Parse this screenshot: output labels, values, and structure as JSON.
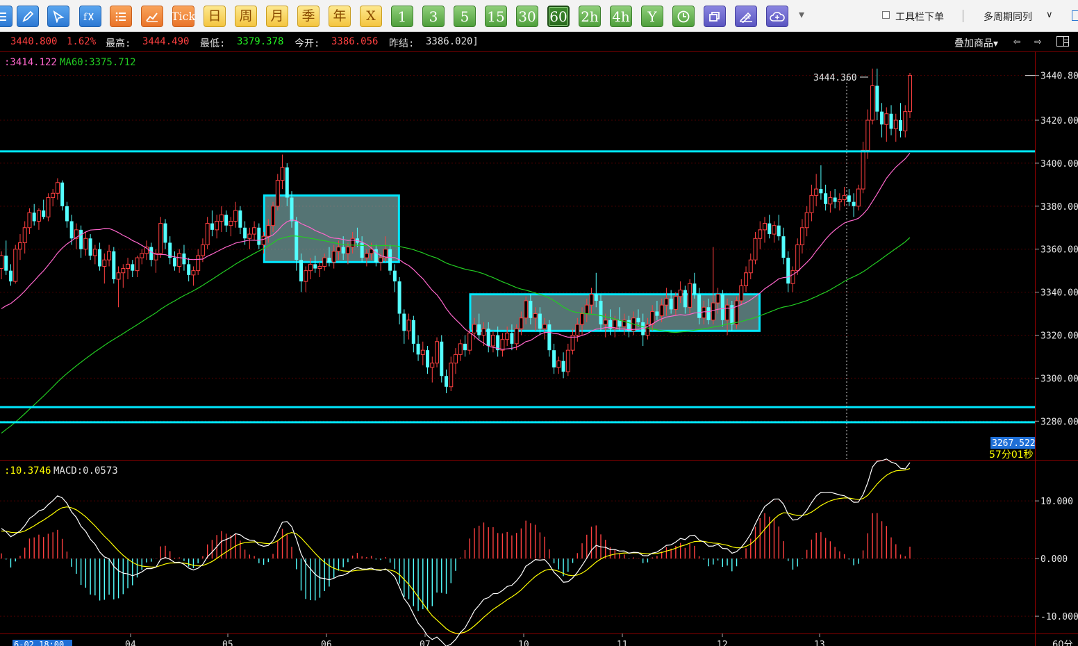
{
  "toolbar": {
    "buttons": [
      {
        "label": "",
        "icon": "menu-list-icon",
        "style": "blue"
      },
      {
        "label": "",
        "icon": "pencil-icon",
        "style": "blue"
      },
      {
        "label": "",
        "icon": "cursor-icon",
        "style": "blue"
      },
      {
        "label": "",
        "icon": "fx-formula-icon",
        "style": "blue"
      },
      {
        "label": "",
        "icon": "list-icon",
        "style": "orange"
      },
      {
        "label": "",
        "icon": "trend-chart-icon",
        "style": "orange"
      },
      {
        "label": "Tick",
        "icon": "",
        "style": "orange"
      },
      {
        "label": "日",
        "icon": "",
        "style": "yellow"
      },
      {
        "label": "周",
        "icon": "",
        "style": "yellow"
      },
      {
        "label": "月",
        "icon": "",
        "style": "yellow"
      },
      {
        "label": "季",
        "icon": "",
        "style": "yellow"
      },
      {
        "label": "年",
        "icon": "",
        "style": "yellow"
      },
      {
        "label": "X",
        "icon": "",
        "style": "yellow"
      },
      {
        "label": "1",
        "icon": "",
        "style": "green"
      },
      {
        "label": "3",
        "icon": "",
        "style": "green"
      },
      {
        "label": "5",
        "icon": "",
        "style": "green"
      },
      {
        "label": "15",
        "icon": "",
        "style": "green"
      },
      {
        "label": "30",
        "icon": "",
        "style": "green"
      },
      {
        "label": "60",
        "icon": "",
        "style": "green",
        "selected": true
      },
      {
        "label": "2h",
        "icon": "",
        "style": "green"
      },
      {
        "label": "4h",
        "icon": "",
        "style": "green"
      },
      {
        "label": "Y",
        "icon": "",
        "style": "green"
      },
      {
        "label": "",
        "icon": "clock-icon",
        "style": "green"
      },
      {
        "label": "",
        "icon": "window-stack-icon",
        "style": "purple"
      },
      {
        "label": "",
        "icon": "draw-tool-icon",
        "style": "purple"
      },
      {
        "label": "",
        "icon": "cloud-add-icon",
        "style": "purple"
      }
    ],
    "dropdown_arrow": "▾",
    "checkbox_label": "工具栏下单",
    "checkbox_checked": false,
    "multi_period_label": "多周期同列",
    "multi_period_arrow": "∨"
  },
  "infobar": {
    "last_price": "3440.800",
    "change_pct": "1.62%",
    "high_label": "最高:",
    "high_value": "3444.490",
    "low_label": "最低:",
    "low_value": "3379.378",
    "open_label": "今开:",
    "open_value": "3386.056",
    "prev_close_label": "昨结:",
    "prev_close_value": "3386.020]",
    "overlay_label": "叠加商品▾",
    "nav_left": "⇦",
    "nav_right": "⇨",
    "layout_icon": "panel-layout-icon"
  },
  "ma_legend": {
    "ma20": ":3414.122",
    "ma60": "MA60:3375.712"
  },
  "macd_legend": {
    "dea": ":10.3746",
    "macd": "MACD:0.0573"
  },
  "price_axis": {
    "ticks": [
      "3440.80",
      "3420.00",
      "3400.00",
      "3380.00",
      "3360.00",
      "3340.00",
      "3320.00",
      "3300.00",
      "3280.00"
    ],
    "current_price_marker": "3440.80",
    "cursor_price": "3267.522",
    "countdown": "57分01秒",
    "high_annotation": "3444.360"
  },
  "macd_axis": {
    "ticks": [
      "10.000",
      "0.000",
      "-10.000"
    ]
  },
  "time_axis": {
    "selected_label": "6-02 18:00",
    "labels": [
      "04",
      "05",
      "06",
      "07",
      "10",
      "11",
      "12",
      "13"
    ],
    "period_label": "60分"
  },
  "colors": {
    "up": "#ff4040",
    "down": "#54ffff",
    "ma20": "#ff66cc",
    "ma60": "#22cc22",
    "macd_diff": "#ffffff",
    "macd_dea": "#ffff00",
    "level_line": "#00e8ff",
    "grid": "#5a0000"
  },
  "chart_data": {
    "type": "candlestick",
    "y_range": [
      3262,
      3452
    ],
    "macd_range": [
      -13,
      17
    ],
    "candles": [
      [
        3351,
        3359,
        3346,
        3357
      ],
      [
        3357,
        3364,
        3348,
        3350
      ],
      [
        3350,
        3353,
        3343,
        3345
      ],
      [
        3345,
        3362,
        3344,
        3360
      ],
      [
        3360,
        3367,
        3355,
        3363
      ],
      [
        3363,
        3373,
        3358,
        3370
      ],
      [
        3370,
        3379,
        3367,
        3377
      ],
      [
        3377,
        3381,
        3371,
        3373
      ],
      [
        3373,
        3379,
        3369,
        3378
      ],
      [
        3378,
        3383,
        3374,
        3375
      ],
      [
        3375,
        3386,
        3373,
        3384
      ],
      [
        3384,
        3388,
        3380,
        3386
      ],
      [
        3386,
        3393,
        3383,
        3391
      ],
      [
        3391,
        3392,
        3378,
        3380
      ],
      [
        3380,
        3382,
        3370,
        3373
      ],
      [
        3373,
        3376,
        3362,
        3365
      ],
      [
        3365,
        3372,
        3360,
        3369
      ],
      [
        3369,
        3371,
        3356,
        3360
      ],
      [
        3360,
        3368,
        3357,
        3365
      ],
      [
        3365,
        3367,
        3355,
        3357
      ],
      [
        3357,
        3362,
        3353,
        3360
      ],
      [
        3360,
        3363,
        3350,
        3352
      ],
      [
        3352,
        3358,
        3344,
        3355
      ],
      [
        3355,
        3362,
        3352,
        3359
      ],
      [
        3359,
        3361,
        3344,
        3346
      ],
      [
        3346,
        3352,
        3333,
        3349
      ],
      [
        3349,
        3353,
        3342,
        3351
      ],
      [
        3351,
        3356,
        3346,
        3353
      ],
      [
        3353,
        3355,
        3347,
        3350
      ],
      [
        3350,
        3357,
        3347,
        3356
      ],
      [
        3356,
        3360,
        3353,
        3358
      ],
      [
        3358,
        3364,
        3355,
        3361
      ],
      [
        3361,
        3363,
        3352,
        3355
      ],
      [
        3355,
        3360,
        3349,
        3358
      ],
      [
        3358,
        3375,
        3356,
        3372
      ],
      [
        3372,
        3374,
        3360,
        3363
      ],
      [
        3363,
        3366,
        3353,
        3356
      ],
      [
        3356,
        3359,
        3350,
        3352
      ],
      [
        3352,
        3360,
        3349,
        3358
      ],
      [
        3358,
        3362,
        3350,
        3353
      ],
      [
        3353,
        3356,
        3345,
        3348
      ],
      [
        3348,
        3352,
        3343,
        3350
      ],
      [
        3350,
        3360,
        3348,
        3357
      ],
      [
        3357,
        3365,
        3354,
        3362
      ],
      [
        3362,
        3375,
        3360,
        3372
      ],
      [
        3372,
        3378,
        3366,
        3369
      ],
      [
        3369,
        3376,
        3365,
        3373
      ],
      [
        3373,
        3380,
        3368,
        3376
      ],
      [
        3376,
        3378,
        3368,
        3371
      ],
      [
        3371,
        3375,
        3366,
        3373
      ],
      [
        3373,
        3382,
        3370,
        3378
      ],
      [
        3378,
        3380,
        3367,
        3370
      ],
      [
        3370,
        3373,
        3362,
        3365
      ],
      [
        3365,
        3370,
        3360,
        3367
      ],
      [
        3367,
        3373,
        3364,
        3370
      ],
      [
        3370,
        3372,
        3360,
        3362
      ],
      [
        3362,
        3368,
        3358,
        3366
      ],
      [
        3366,
        3374,
        3363,
        3371
      ],
      [
        3371,
        3382,
        3368,
        3380
      ],
      [
        3380,
        3395,
        3378,
        3392
      ],
      [
        3392,
        3404,
        3388,
        3398
      ],
      [
        3398,
        3400,
        3380,
        3384
      ],
      [
        3384,
        3387,
        3370,
        3373
      ],
      [
        3373,
        3375,
        3350,
        3355
      ],
      [
        3355,
        3358,
        3340,
        3345
      ],
      [
        3345,
        3352,
        3340,
        3350
      ],
      [
        3350,
        3356,
        3346,
        3353
      ],
      [
        3353,
        3357,
        3349,
        3351
      ],
      [
        3351,
        3354,
        3347,
        3352
      ],
      [
        3352,
        3358,
        3350,
        3356
      ],
      [
        3356,
        3361,
        3352,
        3354
      ],
      [
        3354,
        3362,
        3351,
        3359
      ],
      [
        3359,
        3364,
        3355,
        3361
      ],
      [
        3361,
        3366,
        3355,
        3358
      ],
      [
        3358,
        3363,
        3353,
        3361
      ],
      [
        3361,
        3368,
        3358,
        3365
      ],
      [
        3365,
        3370,
        3361,
        3363
      ],
      [
        3363,
        3366,
        3354,
        3356
      ],
      [
        3356,
        3360,
        3352,
        3358
      ],
      [
        3358,
        3363,
        3355,
        3360
      ],
      [
        3360,
        3362,
        3352,
        3354
      ],
      [
        3354,
        3358,
        3350,
        3356
      ],
      [
        3356,
        3366,
        3354,
        3360
      ],
      [
        3360,
        3362,
        3348,
        3350
      ],
      [
        3350,
        3353,
        3340,
        3345
      ],
      [
        3345,
        3347,
        3325,
        3330
      ],
      [
        3330,
        3332,
        3316,
        3322
      ],
      [
        3322,
        3330,
        3318,
        3327
      ],
      [
        3327,
        3329,
        3312,
        3316
      ],
      [
        3316,
        3320,
        3308,
        3311
      ],
      [
        3311,
        3317,
        3306,
        3313
      ],
      [
        3313,
        3315,
        3302,
        3305
      ],
      [
        3305,
        3310,
        3298,
        3307
      ],
      [
        3307,
        3319,
        3305,
        3317
      ],
      [
        3317,
        3320,
        3298,
        3301
      ],
      [
        3301,
        3304,
        3293,
        3296
      ],
      [
        3296,
        3310,
        3294,
        3307
      ],
      [
        3307,
        3314,
        3302,
        3311
      ],
      [
        3311,
        3318,
        3308,
        3316
      ],
      [
        3316,
        3320,
        3310,
        3313
      ],
      [
        3313,
        3323,
        3311,
        3321
      ],
      [
        3321,
        3328,
        3318,
        3325
      ],
      [
        3325,
        3330,
        3318,
        3320
      ],
      [
        3320,
        3326,
        3315,
        3323
      ],
      [
        3323,
        3326,
        3312,
        3315
      ],
      [
        3315,
        3322,
        3312,
        3320
      ],
      [
        3320,
        3324,
        3310,
        3313
      ],
      [
        3313,
        3321,
        3310,
        3318
      ],
      [
        3318,
        3324,
        3315,
        3321
      ],
      [
        3321,
        3325,
        3313,
        3316
      ],
      [
        3316,
        3325,
        3313,
        3323
      ],
      [
        3323,
        3331,
        3320,
        3328
      ],
      [
        3328,
        3338,
        3325,
        3336
      ],
      [
        3336,
        3339,
        3325,
        3328
      ],
      [
        3328,
        3333,
        3322,
        3330
      ],
      [
        3330,
        3333,
        3320,
        3323
      ],
      [
        3323,
        3328,
        3318,
        3325
      ],
      [
        3325,
        3327,
        3310,
        3313
      ],
      [
        3313,
        3316,
        3302,
        3305
      ],
      [
        3305,
        3310,
        3302,
        3308
      ],
      [
        3308,
        3312,
        3300,
        3303
      ],
      [
        3303,
        3316,
        3301,
        3313
      ],
      [
        3313,
        3323,
        3311,
        3320
      ],
      [
        3320,
        3328,
        3317,
        3325
      ],
      [
        3325,
        3333,
        3320,
        3330
      ],
      [
        3330,
        3337,
        3326,
        3334
      ],
      [
        3334,
        3342,
        3330,
        3339
      ],
      [
        3339,
        3349,
        3333,
        3336
      ],
      [
        3336,
        3339,
        3322,
        3325
      ],
      [
        3325,
        3330,
        3319,
        3327
      ],
      [
        3327,
        3332,
        3320,
        3323
      ],
      [
        3323,
        3329,
        3319,
        3327
      ],
      [
        3327,
        3333,
        3322,
        3324
      ],
      [
        3324,
        3330,
        3320,
        3327
      ],
      [
        3327,
        3329,
        3319,
        3322
      ],
      [
        3322,
        3331,
        3320,
        3328
      ],
      [
        3328,
        3332,
        3324,
        3326
      ],
      [
        3326,
        3330,
        3315,
        3320
      ],
      [
        3320,
        3328,
        3318,
        3325
      ],
      [
        3325,
        3334,
        3322,
        3331
      ],
      [
        3331,
        3336,
        3327,
        3329
      ],
      [
        3329,
        3337,
        3326,
        3334
      ],
      [
        3334,
        3342,
        3329,
        3337
      ],
      [
        3337,
        3341,
        3330,
        3332
      ],
      [
        3332,
        3340,
        3329,
        3338
      ],
      [
        3338,
        3345,
        3335,
        3341
      ],
      [
        3341,
        3343,
        3330,
        3333
      ],
      [
        3333,
        3346,
        3330,
        3344
      ],
      [
        3344,
        3349,
        3337,
        3339
      ],
      [
        3339,
        3342,
        3325,
        3328
      ],
      [
        3328,
        3336,
        3325,
        3333
      ],
      [
        3333,
        3337,
        3325,
        3327
      ],
      [
        3327,
        3361,
        3325,
        3335
      ],
      [
        3335,
        3342,
        3330,
        3339
      ],
      [
        3339,
        3341,
        3324,
        3327
      ],
      [
        3327,
        3337,
        3320,
        3334
      ],
      [
        3334,
        3336,
        3322,
        3325
      ],
      [
        3325,
        3338,
        3323,
        3336
      ],
      [
        3336,
        3346,
        3334,
        3343
      ],
      [
        3343,
        3352,
        3340,
        3349
      ],
      [
        3349,
        3358,
        3346,
        3355
      ],
      [
        3355,
        3368,
        3353,
        3365
      ],
      [
        3365,
        3373,
        3360,
        3369
      ],
      [
        3369,
        3375,
        3363,
        3372
      ],
      [
        3372,
        3376,
        3365,
        3367
      ],
      [
        3367,
        3373,
        3363,
        3371
      ],
      [
        3371,
        3376,
        3364,
        3366
      ],
      [
        3366,
        3370,
        3353,
        3356
      ],
      [
        3356,
        3359,
        3340,
        3344
      ],
      [
        3344,
        3352,
        3340,
        3350
      ],
      [
        3350,
        3365,
        3348,
        3362
      ],
      [
        3362,
        3374,
        3358,
        3370
      ],
      [
        3370,
        3380,
        3366,
        3377
      ],
      [
        3377,
        3390,
        3373,
        3385
      ],
      [
        3385,
        3395,
        3380,
        3388
      ],
      [
        3388,
        3399,
        3383,
        3386
      ],
      [
        3386,
        3390,
        3378,
        3381
      ],
      [
        3381,
        3387,
        3377,
        3384
      ],
      [
        3384,
        3388,
        3379,
        3382
      ],
      [
        3382,
        3386,
        3378,
        3383
      ],
      [
        3383,
        3389,
        3380,
        3385
      ],
      [
        3385,
        3388,
        3380,
        3382
      ],
      [
        3382,
        3386,
        3375,
        3380
      ],
      [
        3380,
        3390,
        3378,
        3388
      ],
      [
        3388,
        3410,
        3386,
        3406
      ],
      [
        3406,
        3425,
        3402,
        3420
      ],
      [
        3420,
        3444,
        3418,
        3436
      ],
      [
        3436,
        3444,
        3420,
        3424
      ],
      [
        3424,
        3428,
        3412,
        3418
      ],
      [
        3418,
        3426,
        3410,
        3423
      ],
      [
        3423,
        3427,
        3413,
        3416
      ],
      [
        3416,
        3423,
        3410,
        3420
      ],
      [
        3420,
        3428,
        3412,
        3415
      ],
      [
        3415,
        3427,
        3412,
        3424
      ],
      [
        3424,
        3442,
        3421,
        3440.8
      ]
    ]
  }
}
